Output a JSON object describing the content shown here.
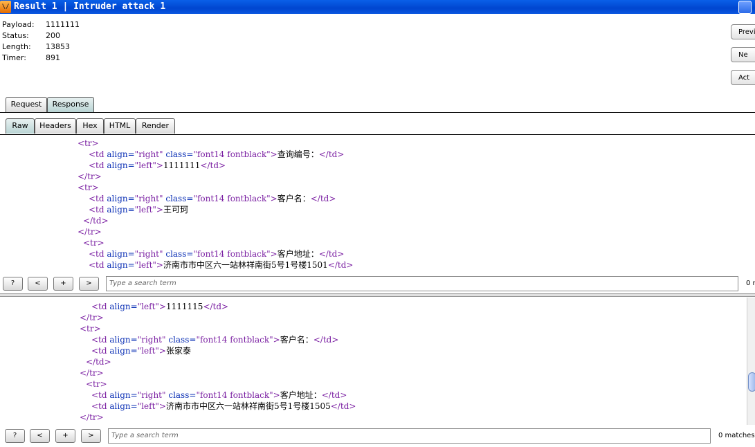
{
  "window": {
    "title": "Result 1 | Intruder attack 1",
    "app_icon_label": "\\/"
  },
  "info": {
    "payload_label": "Payload:",
    "payload": "1111111",
    "status_label": "Status:",
    "status": "200",
    "length_label": "Length:",
    "length": "13853",
    "timer_label": "Timer:",
    "timer": "891"
  },
  "side_buttons": [
    "Previ",
    "Ne",
    "Act"
  ],
  "tabs_top": [
    "Request",
    "Response"
  ],
  "tabs_view": [
    "Raw",
    "Headers",
    "Hex",
    "HTML",
    "Render"
  ],
  "search": {
    "help": "?",
    "prev": "<",
    "plus": "+",
    "next": ">",
    "placeholder": "Type a search term",
    "matches_top": "0 n",
    "matches_bottom": "0 matches"
  },
  "code_top": [
    [
      [
        "tag",
        "<tr>"
      ]
    ],
    [
      [
        "tag",
        "<td "
      ],
      [
        "attr",
        "align="
      ],
      [
        "str",
        "\"right\" "
      ],
      [
        "attr",
        "class="
      ],
      [
        "str",
        "\"font14 fontblack\""
      ],
      [
        "tag",
        ">"
      ],
      [
        "txt",
        "查询编号："
      ],
      [
        "tag",
        "</td>"
      ]
    ],
    [
      [
        "tag",
        "<td "
      ],
      [
        "attr",
        "align="
      ],
      [
        "str",
        "\"left\""
      ],
      [
        "tag",
        ">"
      ],
      [
        "txt",
        "1111111"
      ],
      [
        "tag",
        "</td>"
      ]
    ],
    [
      [
        "tag",
        "</tr>"
      ]
    ],
    [
      [
        "tag",
        "<tr>"
      ]
    ],
    [
      [
        "tag",
        "<td "
      ],
      [
        "attr",
        "align="
      ],
      [
        "str",
        "\"right\" "
      ],
      [
        "attr",
        "class="
      ],
      [
        "str",
        "\"font14 fontblack\""
      ],
      [
        "tag",
        ">"
      ],
      [
        "txt",
        "客户名："
      ],
      [
        "tag",
        "</td>"
      ]
    ],
    [
      [
        "tag",
        "<td "
      ],
      [
        "attr",
        "align="
      ],
      [
        "str",
        "\"left\""
      ],
      [
        "tag",
        ">"
      ],
      [
        "txt",
        "王可珂"
      ]
    ],
    [
      [
        "tag",
        "</td>"
      ]
    ],
    [
      [
        "tag",
        "</tr>"
      ]
    ],
    [
      [
        "tag",
        "<tr>"
      ]
    ],
    [
      [
        "tag",
        "<td "
      ],
      [
        "attr",
        "align="
      ],
      [
        "str",
        "\"right\" "
      ],
      [
        "attr",
        "class="
      ],
      [
        "str",
        "\"font14 fontblack\""
      ],
      [
        "tag",
        ">"
      ],
      [
        "txt",
        "客户地址："
      ],
      [
        "tag",
        "</td>"
      ]
    ],
    [
      [
        "tag",
        "<td "
      ],
      [
        "attr",
        "align="
      ],
      [
        "str",
        "\"left\""
      ],
      [
        "tag",
        ">"
      ],
      [
        "txt",
        "济南市市中区六一站林祥南街5号1号楼1501"
      ],
      [
        "tag",
        "</td>"
      ]
    ]
  ],
  "code_bottom": [
    [
      [
        "tag",
        "<td "
      ],
      [
        "attr",
        "align="
      ],
      [
        "str",
        "\"left\""
      ],
      [
        "tag",
        ">"
      ],
      [
        "txt",
        "1111115"
      ],
      [
        "tag",
        "</td>"
      ]
    ],
    [
      [
        "tag",
        "</tr>"
      ]
    ],
    [
      [
        "tag",
        "<tr>"
      ]
    ],
    [
      [
        "tag",
        "<td "
      ],
      [
        "attr",
        "align="
      ],
      [
        "str",
        "\"right\" "
      ],
      [
        "attr",
        "class="
      ],
      [
        "str",
        "\"font14 fontblack\""
      ],
      [
        "tag",
        ">"
      ],
      [
        "txt",
        "客户名："
      ],
      [
        "tag",
        "</td>"
      ]
    ],
    [
      [
        "tag",
        "<td "
      ],
      [
        "attr",
        "align="
      ],
      [
        "str",
        "\"left\""
      ],
      [
        "tag",
        ">"
      ],
      [
        "txt",
        "张家泰"
      ]
    ],
    [
      [
        "tag",
        "</td>"
      ]
    ],
    [
      [
        "tag",
        "</tr>"
      ]
    ],
    [
      [
        "tag",
        "<tr>"
      ]
    ],
    [
      [
        "tag",
        "<td "
      ],
      [
        "attr",
        "align="
      ],
      [
        "str",
        "\"right\" "
      ],
      [
        "attr",
        "class="
      ],
      [
        "str",
        "\"font14 fontblack\""
      ],
      [
        "tag",
        ">"
      ],
      [
        "txt",
        "客户地址："
      ],
      [
        "tag",
        "</td>"
      ]
    ],
    [
      [
        "tag",
        "<td "
      ],
      [
        "attr",
        "align="
      ],
      [
        "str",
        "\"left\""
      ],
      [
        "tag",
        ">"
      ],
      [
        "txt",
        "济南市市中区六一站林祥南街5号1号楼1505"
      ],
      [
        "tag",
        "</td>"
      ]
    ],
    [
      [
        "tag",
        "</tr>"
      ]
    ]
  ]
}
